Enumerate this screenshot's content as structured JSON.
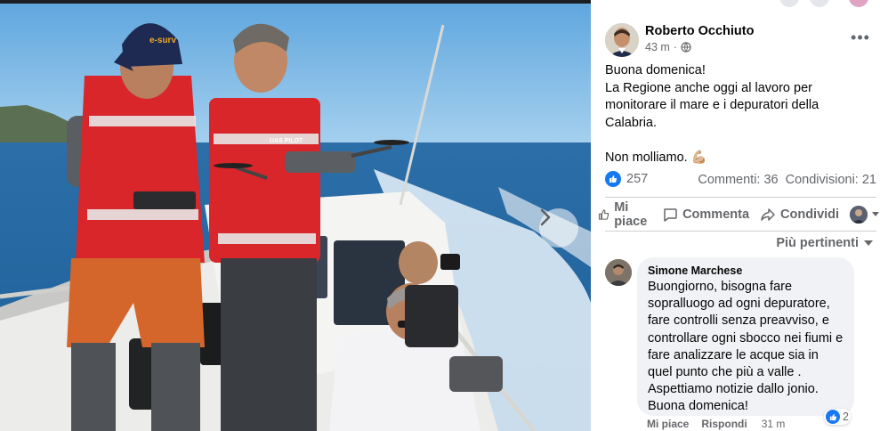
{
  "post": {
    "author": "Roberto Occhiuto",
    "time": "43 m",
    "privacy_icon": "globe-icon",
    "more_label": "•••",
    "text_line1": "Buona domenica!",
    "text_line2": "La Regione anche oggi al lavoro per monitorare il mare e i depuratori della Calabria.",
    "text_line3": "Non molliamo. 💪🏼"
  },
  "photo": {
    "cap_logo": "e-surv",
    "vest_badge": "UAS PILOT"
  },
  "stats": {
    "reactions": "257",
    "comments": "Commenti: 36",
    "shares": "Condivisioni: 21"
  },
  "actions": {
    "like": "Mi piace",
    "comment": "Commenta",
    "share": "Condividi"
  },
  "sort_label": "Più pertinenti",
  "comment": {
    "author": "Simone Marchese",
    "text": "Buongiorno, bisogna fare sopralluogo ad ogni depuratore, fare controlli senza preavviso, e controllare ogni sbocco nei fiumi e fare analizzare le acque sia in quel punto che più a valle . Aspettiamo notizie dallo jonio. Buona domenica!",
    "reactions": "2",
    "like": "Mi piace",
    "reply": "Rispondi",
    "time": "31 m"
  },
  "colors": {
    "facebook_blue": "#1877f2",
    "muted_text": "#65676b",
    "comment_bg": "#f0f2f5"
  }
}
